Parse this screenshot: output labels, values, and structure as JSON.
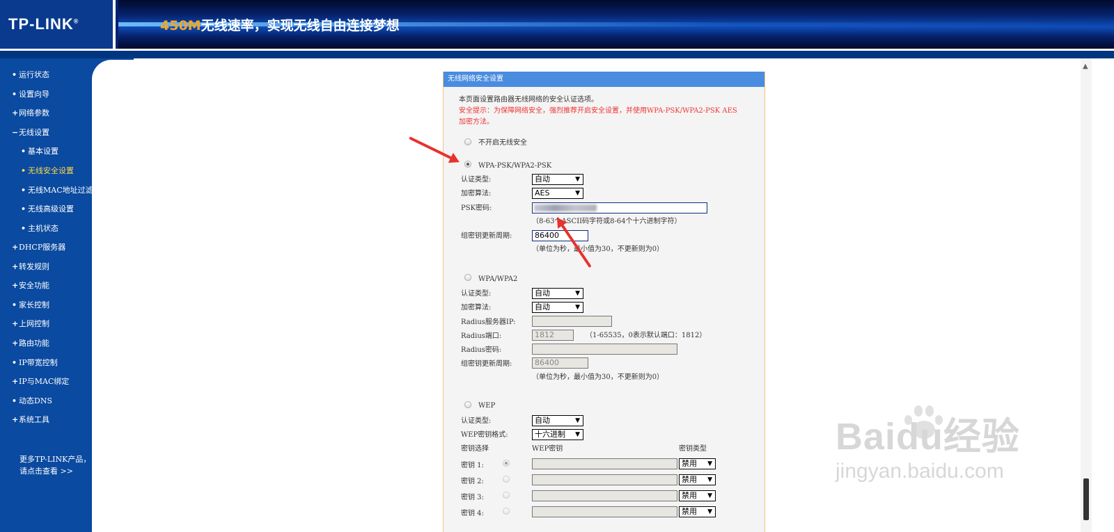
{
  "header": {
    "logo": "TP-LINK",
    "logo_mark": "®",
    "slogan_accent": "450M",
    "slogan_rest": "无线速率，实现无线自由连接梦想"
  },
  "sidebar": {
    "items": [
      {
        "marker": "•",
        "label": "运行状态"
      },
      {
        "marker": "•",
        "label": "设置向导"
      },
      {
        "marker": "+",
        "label": "网络参数"
      },
      {
        "marker": "−",
        "label": "无线设置"
      },
      {
        "marker": "•",
        "label": "基本设置"
      },
      {
        "marker": "•",
        "label": "无线安全设置"
      },
      {
        "marker": "•",
        "label": "无线MAC地址过滤"
      },
      {
        "marker": "•",
        "label": "无线高级设置"
      },
      {
        "marker": "•",
        "label": "主机状态"
      },
      {
        "marker": "+",
        "label": "DHCP服务器"
      },
      {
        "marker": "+",
        "label": "转发规则"
      },
      {
        "marker": "+",
        "label": "安全功能"
      },
      {
        "marker": "•",
        "label": "家长控制"
      },
      {
        "marker": "+",
        "label": "上网控制"
      },
      {
        "marker": "+",
        "label": "路由功能"
      },
      {
        "marker": "•",
        "label": "IP带宽控制"
      },
      {
        "marker": "+",
        "label": "IP与MAC绑定"
      },
      {
        "marker": "•",
        "label": "动态DNS"
      },
      {
        "marker": "+",
        "label": "系统工具"
      }
    ],
    "more_line1": "更多TP-LINK产品，",
    "more_line2": "请点击查看 >>"
  },
  "panel": {
    "title": "无线网络安全设置",
    "intro": "本页面设置路由器无线网络的安全认证选项。",
    "warning_line1": "安全提示：为保障网络安全，强烈推荐开启安全设置，并使用WPA-PSK/WPA2-PSK AES",
    "warning_line2": "加密方法。",
    "opt_none": "不开启无线安全",
    "wpa_psk": {
      "title": "WPA-PSK/WPA2-PSK",
      "auth_label": "认证类型:",
      "auth_value": "自动",
      "enc_label": "加密算法:",
      "enc_value": "AES",
      "psk_label": "PSK密码:",
      "psk_hint": "（8-63个ASCII码字符或8-64个十六进制字符）",
      "period_label": "组密钥更新周期:",
      "period_value": "86400",
      "period_hint": "（单位为秒，最小值为30，不更新则为0）"
    },
    "wpa": {
      "title": "WPA/WPA2",
      "auth_label": "认证类型:",
      "auth_value": "自动",
      "enc_label": "加密算法:",
      "enc_value": "自动",
      "radius_ip_label": "Radius服务器IP:",
      "radius_port_label": "Radius端口:",
      "radius_port_value": "1812",
      "radius_port_hint": "（1-65535，0表示默认端口：1812）",
      "radius_pw_label": "Radius密码:",
      "period_label": "组密钥更新周期:",
      "period_value": "86400",
      "period_hint": "（单位为秒，最小值为30，不更新则为0）"
    },
    "wep": {
      "title": "WEP",
      "auth_label": "认证类型:",
      "auth_value": "自动",
      "format_label": "WEP密钥格式:",
      "format_value": "十六进制",
      "col_select": "密钥选择",
      "col_key": "WEP密钥",
      "col_type": "密钥类型",
      "keys": [
        {
          "label": "密钥 1:",
          "type": "禁用"
        },
        {
          "label": "密钥 2:",
          "type": "禁用"
        },
        {
          "label": "密钥 3:",
          "type": "禁用"
        },
        {
          "label": "密钥 4:",
          "type": "禁用"
        }
      ]
    }
  },
  "watermark": {
    "main": "Baidu经验",
    "sub": "jingyan.baidu.com"
  },
  "colors": {
    "sidebar_bg": "#0a4aa0",
    "active_nav": "#ffd84a",
    "panel_header": "#4a8ce0",
    "warning_red": "#e33333",
    "annotation_arrow": "#e8322e"
  }
}
